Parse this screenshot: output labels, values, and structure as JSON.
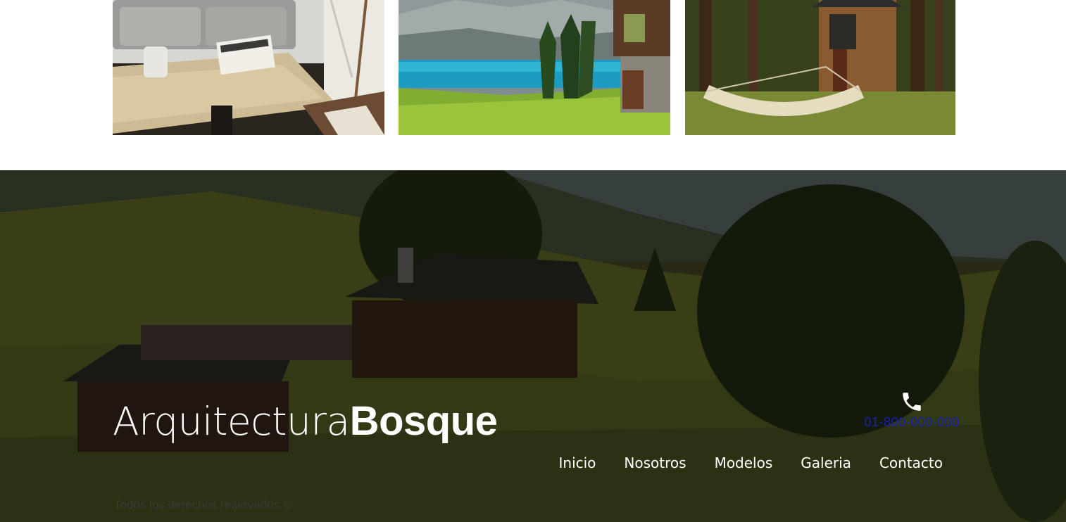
{
  "gallery": {
    "images": [
      {
        "alt": "living-room-image"
      },
      {
        "alt": "mountain-lake-cabin-image"
      },
      {
        "alt": "forest-cabin-hammock-image"
      }
    ]
  },
  "footer": {
    "logo": {
      "light": "Arquitectura",
      "bold": "Bosque"
    },
    "phone": {
      "icon": "phone-icon",
      "number": "01-800-000-000"
    },
    "nav": [
      "Inicio",
      "Nosotros",
      "Modelos",
      "Galeria",
      "Contacto"
    ],
    "copyright": "Todos los derechos reservados ©"
  },
  "colors": {
    "overlay": "#000000",
    "text": "#ffffff",
    "phone_link": "#1a1fb0",
    "copyright": "#3a3a3a"
  }
}
